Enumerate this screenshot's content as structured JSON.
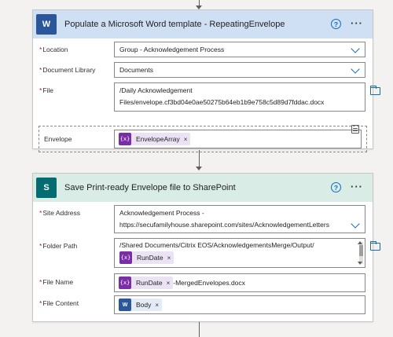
{
  "card1": {
    "title": "Populate a Microsoft Word template - RepeatingEnvelope",
    "icon": "word-icon",
    "icon_glyph": "W",
    "help_glyph": "?",
    "more_glyph": "···",
    "location": {
      "label": "Location",
      "value": "Group - Acknowledgement Process"
    },
    "document_library": {
      "label": "Document Library",
      "value": "Documents"
    },
    "file": {
      "label": "File",
      "line1": "/Daily Acknowledgement",
      "line2": "Files/envelope.cf3bd04e0ae50275b64eb1b9e758c5d89d7fddac.docx"
    },
    "envelope": {
      "label": "Envelope",
      "token": "EnvelopeArray"
    }
  },
  "card2": {
    "title": "Save Print-ready Envelope file to SharePoint",
    "icon": "sharepoint-icon",
    "icon_glyph": "S",
    "help_glyph": "?",
    "more_glyph": "···",
    "site_address": {
      "label": "Site Address",
      "line1": "Acknowledgement Process -",
      "line2": "https://secufamilyhouse.sharepoint.com/sites/AcknowledgementLetters"
    },
    "folder_path": {
      "label": "Folder Path",
      "line1": "/Shared Documents/Citrix EOS/AcknowledgementsMerge/Output/",
      "token": "RunDate"
    },
    "file_name": {
      "label": "File Name",
      "token": "RunDate",
      "suffix": "-MergedEnvelopes.docx"
    },
    "file_content": {
      "label": "File Content",
      "token": "Body"
    }
  },
  "common": {
    "required_mark": "*",
    "remove_glyph": "×",
    "expr_glyph": "{x}",
    "word_glyph": "W"
  },
  "colors": {
    "word_header": "#d0e0f4",
    "sharepoint_header": "#d9ece6",
    "accent": "#0f6cbd",
    "token_bg": "#ebe3f4",
    "token_icon": "#7a2ea6"
  }
}
